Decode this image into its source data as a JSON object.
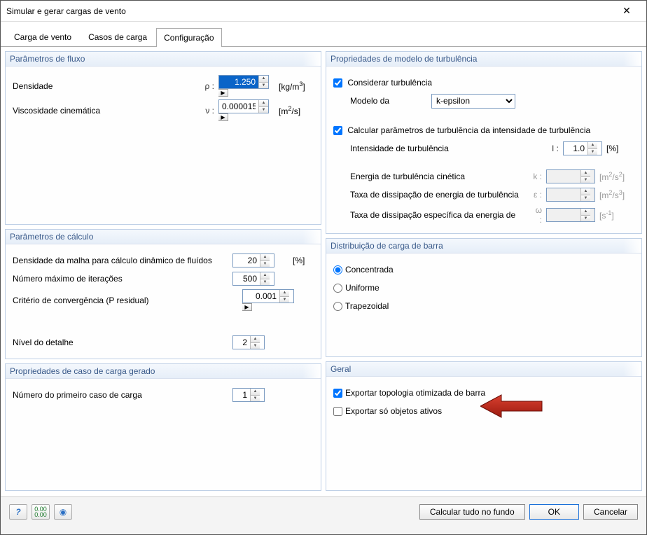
{
  "window": {
    "title": "Simular e gerar cargas de vento"
  },
  "tabs": {
    "items": [
      {
        "label": "Carga de vento"
      },
      {
        "label": "Casos de carga"
      },
      {
        "label": "Configuração"
      }
    ],
    "activeIndex": 2
  },
  "panels": {
    "flow": {
      "title": "Parâmetros de fluxo",
      "density_label": "Densidade",
      "density_sym": "ρ :",
      "density_value": "1.250",
      "density_unit_html": "[kg/m<sup>3</sup>]",
      "viscosity_label": "Viscosidade cinemática",
      "viscosity_sym": "ν :",
      "viscosity_value": "0.000015",
      "viscosity_unit_html": "[m<sup>2</sup>/s]"
    },
    "calc": {
      "title": "Parâmetros de cálculo",
      "mesh_label": "Densidade da malha para cálculo dinâmico de fluídos",
      "mesh_value": "20",
      "mesh_unit": "[%]",
      "iter_label": "Número máximo de iterações",
      "iter_value": "500",
      "conv_label": "Critério de convergência (P residual)",
      "conv_value": "0.001",
      "detail_label": "Nível do detalhe",
      "detail_value": "2"
    },
    "loadcase": {
      "title": "Propriedades de caso de carga gerado",
      "first_label": "Número do primeiro caso de carga",
      "first_value": "1"
    },
    "turb": {
      "title": "Propriedades de modelo de turbulência",
      "consider_label": "Considerar turbulência",
      "consider_checked": true,
      "model_label": "Modelo da",
      "model_value": "k-epsilon",
      "model_options": [
        "k-epsilon"
      ],
      "calc_params_label": "Calcular parâmetros de turbulência da intensidade de turbulência",
      "calc_params_checked": true,
      "intensity_label": "Intensidade de turbulência",
      "intensity_sym": "I :",
      "intensity_value": "1.0",
      "intensity_unit": "[%]",
      "kinetic_label": "Energia de turbulência cinética",
      "kinetic_sym": "k :",
      "kinetic_unit_html": "[m<sup>2</sup>/s<sup>2</sup>]",
      "dissip_label": "Taxa de dissipação de energia de turbulência",
      "dissip_sym": "ε :",
      "dissip_unit_html": "[m<sup>2</sup>/s<sup>3</sup>]",
      "specific_label": "Taxa de dissipação específica da energia de",
      "specific_sym": "ω :",
      "specific_unit_html": "[s<sup>-1</sup>]"
    },
    "dist": {
      "title": "Distribuição de carga de barra",
      "opt1": "Concentrada",
      "opt2": "Uniforme",
      "opt3": "Trapezoidal",
      "selected": "Concentrada"
    },
    "general": {
      "title": "Geral",
      "export_topo": "Exportar topologia otimizada de barra",
      "export_topo_checked": true,
      "export_active": "Exportar só objetos ativos",
      "export_active_checked": false
    }
  },
  "footer": {
    "calc_bg": "Calcular tudo no fundo",
    "ok": "OK",
    "cancel": "Cancelar"
  }
}
